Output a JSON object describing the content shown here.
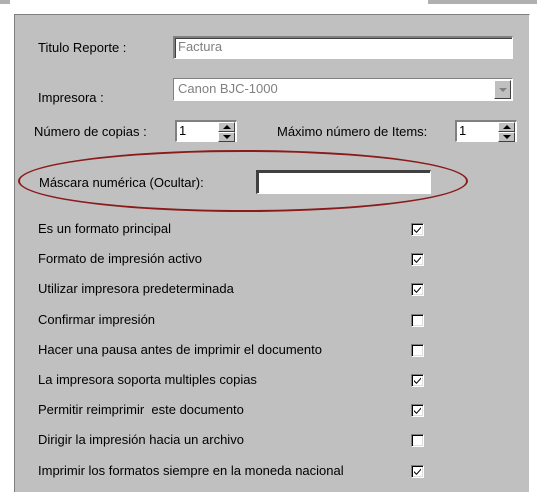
{
  "form": {
    "titulo_label": "Titulo Reporte :",
    "titulo_value": "Factura",
    "impresora_label": "Impresora :",
    "impresora_value": "Canon BJC-1000",
    "copias_label": "Número de copias :",
    "copias_value": "1",
    "max_items_label": "Máximo número de Items:",
    "max_items_value": "1",
    "mascara_label": "Máscara numérica (Ocultar):",
    "mascara_value": ""
  },
  "options": [
    {
      "label": "Es un formato principal",
      "checked": true
    },
    {
      "label": "Formato de impresión activo",
      "checked": true
    },
    {
      "label": "Utilizar impresora predeterminada",
      "checked": true
    },
    {
      "label": "Confirmar impresión",
      "checked": false
    },
    {
      "label": "Hacer una pausa antes de imprimir el documento",
      "checked": false
    },
    {
      "label": "La impresora soporta multiples copias",
      "checked": true
    },
    {
      "label": "Permitir reimprimir  este documento",
      "checked": true
    },
    {
      "label": "Dirigir la impresión hacia un archivo",
      "checked": false
    },
    {
      "label": "Imprimir los formatos siempre en la moneda nacional",
      "checked": true
    }
  ],
  "colors": {
    "panel": "#c0c0c0",
    "highlight_oval": "#8b1a1a"
  }
}
